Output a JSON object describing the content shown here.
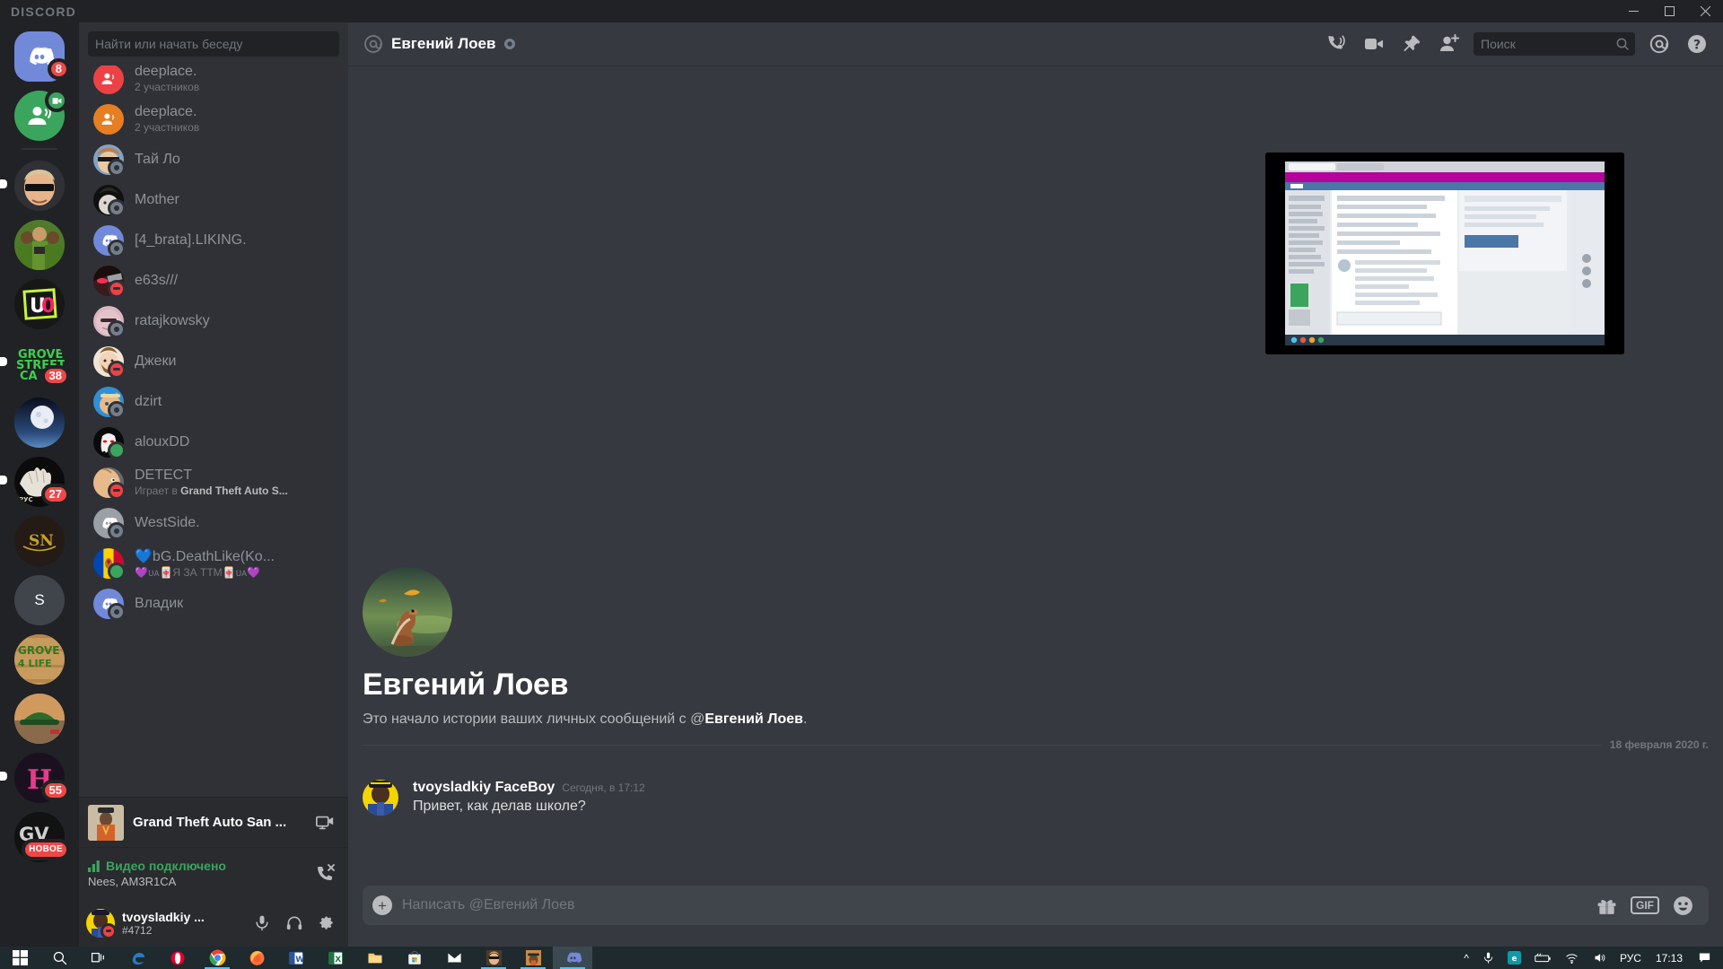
{
  "window": {
    "app_wordmark": "DISCORD",
    "minimize_label": "—",
    "maximize_label": "□",
    "close_label": "✕"
  },
  "guilds": [
    {
      "name": "home",
      "type": "discord-home",
      "badge": "8",
      "indicator": "none"
    },
    {
      "name": "friends-voice",
      "type": "friends",
      "badge": "",
      "indicator": "none",
      "camera": true
    },
    {
      "name": "server-sunglasses-boy",
      "type": "avatar",
      "badge": "",
      "indicator": "sm"
    },
    {
      "name": "server-green-crew",
      "type": "avatar",
      "badge": "",
      "indicator": "none"
    },
    {
      "name": "server-uo",
      "type": "avatar",
      "badge": "",
      "indicator": "none"
    },
    {
      "name": "server-grove-street",
      "type": "avatar",
      "badge": "38",
      "indicator": "sm"
    },
    {
      "name": "server-moon",
      "type": "avatar",
      "badge": "",
      "indicator": "none"
    },
    {
      "name": "server-hand",
      "type": "avatar",
      "badge": "27",
      "indicator": "sm"
    },
    {
      "name": "server-sn",
      "type": "avatar",
      "badge": "",
      "indicator": "none"
    },
    {
      "name": "server-s",
      "type": "letter",
      "letter": "S",
      "badge": "",
      "indicator": "none"
    },
    {
      "name": "server-grove-graffiti",
      "type": "avatar",
      "badge": "",
      "indicator": "none"
    },
    {
      "name": "server-green-cap",
      "type": "avatar",
      "badge": "",
      "indicator": "none"
    },
    {
      "name": "server-pink-h",
      "type": "avatar",
      "badge": "55",
      "indicator": "sm"
    },
    {
      "name": "server-gv",
      "type": "avatar",
      "badge": "НОВОЕ",
      "indicator": "none"
    }
  ],
  "sidebar": {
    "search_placeholder": "Найти или начать беседу",
    "dms": [
      {
        "name": "deeplace.",
        "sub": "2 участников",
        "avatar": "group-red",
        "status": "none"
      },
      {
        "name": "deeplace.",
        "sub": "2 участников",
        "avatar": "group-orange",
        "status": "none"
      },
      {
        "name": "Тай Ло",
        "sub": "",
        "avatar": "photo-tailo",
        "status": "offline"
      },
      {
        "name": "Mother",
        "sub": "",
        "avatar": "photo-mother",
        "status": "offline"
      },
      {
        "name": "[4_brata].LIKING.",
        "sub": "",
        "avatar": "discord-blurple",
        "status": "offline"
      },
      {
        "name": "e63s///",
        "sub": "",
        "avatar": "photo-e63s",
        "status": "dnd"
      },
      {
        "name": "ratajkowsky",
        "sub": "",
        "avatar": "photo-rataj",
        "status": "offline"
      },
      {
        "name": "Джеки",
        "sub": "",
        "avatar": "photo-jackie",
        "status": "dnd"
      },
      {
        "name": "dzirt",
        "sub": "",
        "avatar": "photo-cat",
        "status": "offline"
      },
      {
        "name": "alouxDD",
        "sub": "",
        "avatar": "photo-ghost",
        "status": "online"
      },
      {
        "name": "DETECT",
        "sub_prefix": "Играет в ",
        "sub_game": "Grand Theft Auto S...",
        "avatar": "photo-detect",
        "status": "dnd"
      },
      {
        "name": "WestSide.",
        "sub": "",
        "avatar": "discord-grey",
        "status": "offline"
      },
      {
        "name": "💙bG.DeathLike(Ko...",
        "sub": "💜ᴜᴀ🀄Я ЗА ТТМ🀄ᴜᴀ💜",
        "avatar": "flag-moldova",
        "status": "online"
      },
      {
        "name": "Владик",
        "sub": "",
        "avatar": "discord-blurple",
        "status": "offline"
      }
    ],
    "game_panel": {
      "title": "Grand Theft Auto San ...",
      "stream_icon": "screen-share-icon"
    },
    "voice_panel": {
      "title": "Видео подключено",
      "subtitle": "Nees, AM3R1CA",
      "disconnect_icon": "phone-hangup-icon"
    },
    "user_panel": {
      "username": "tvoysladkiy ...",
      "discriminator": "#4712",
      "mic_icon": "microphone-icon",
      "headset_icon": "headset-icon",
      "settings_icon": "gear-icon"
    }
  },
  "chat": {
    "header": {
      "at_icon": "at-sign-icon",
      "title": "Евгений Лоев",
      "status": "offline",
      "icons": [
        {
          "name": "start-call-icon"
        },
        {
          "name": "video-call-icon"
        },
        {
          "name": "pinned-messages-icon"
        },
        {
          "name": "add-friend-icon"
        }
      ],
      "search_placeholder": "Поиск",
      "mentions_icon": "inbox-at-icon",
      "help_icon": "help-icon"
    },
    "intro": {
      "name": "Евгений Лоев",
      "description_before": "Это начало истории ваших личных сообщений с @",
      "description_name": "Евгений Лоев",
      "description_after": "."
    },
    "date_divider": "18 февраля 2020 г.",
    "messages": [
      {
        "author": "tvoysladkiy FaceBoy",
        "timestamp": "Сегодня, в 17:12",
        "text": "Привет, как делав школе?",
        "avatar": "photo-faceboy"
      }
    ],
    "attachment": {
      "name": "screenshot-attachment",
      "alt": "Скриншот экрана с браузером ВКонтакте"
    },
    "composer": {
      "placeholder": "Написать @Евгений Лоев",
      "value": "",
      "plus_label": "+",
      "gift_icon": "gift-icon",
      "gif_label": "GIF",
      "emoji_icon": "emoji-icon"
    }
  },
  "taskbar": {
    "items": [
      {
        "name": "start-button",
        "icon": "windows-logo"
      },
      {
        "name": "search-button",
        "icon": "magnifier"
      },
      {
        "name": "task-view-button",
        "icon": "task-view"
      },
      {
        "name": "edge-button",
        "icon": "edge"
      },
      {
        "name": "opera-button",
        "icon": "opera"
      },
      {
        "name": "chrome-button",
        "icon": "chrome",
        "running": true
      },
      {
        "name": "firefox-button",
        "icon": "firefox"
      },
      {
        "name": "word-button",
        "icon": "word"
      },
      {
        "name": "excel-button",
        "icon": "excel"
      },
      {
        "name": "explorer-button",
        "icon": "folder"
      },
      {
        "name": "store-button",
        "icon": "store"
      },
      {
        "name": "mail-button",
        "icon": "mail"
      },
      {
        "name": "photo1-button",
        "icon": "photo-sunglasses",
        "running": true
      },
      {
        "name": "photo2-button",
        "icon": "photo-cowboy",
        "running": true
      },
      {
        "name": "discord-button",
        "icon": "discord",
        "running": true,
        "active": true
      }
    ],
    "tray": {
      "chevron": "^",
      "mic_icon": "microphone-icon",
      "edge_icon": "edge-icon",
      "battery_icon": "battery-icon",
      "wifi_icon": "wifi-icon",
      "volume_icon": "volume-icon",
      "language": "РУС",
      "clock": "17:13",
      "action_center_icon": "action-center-icon"
    }
  }
}
